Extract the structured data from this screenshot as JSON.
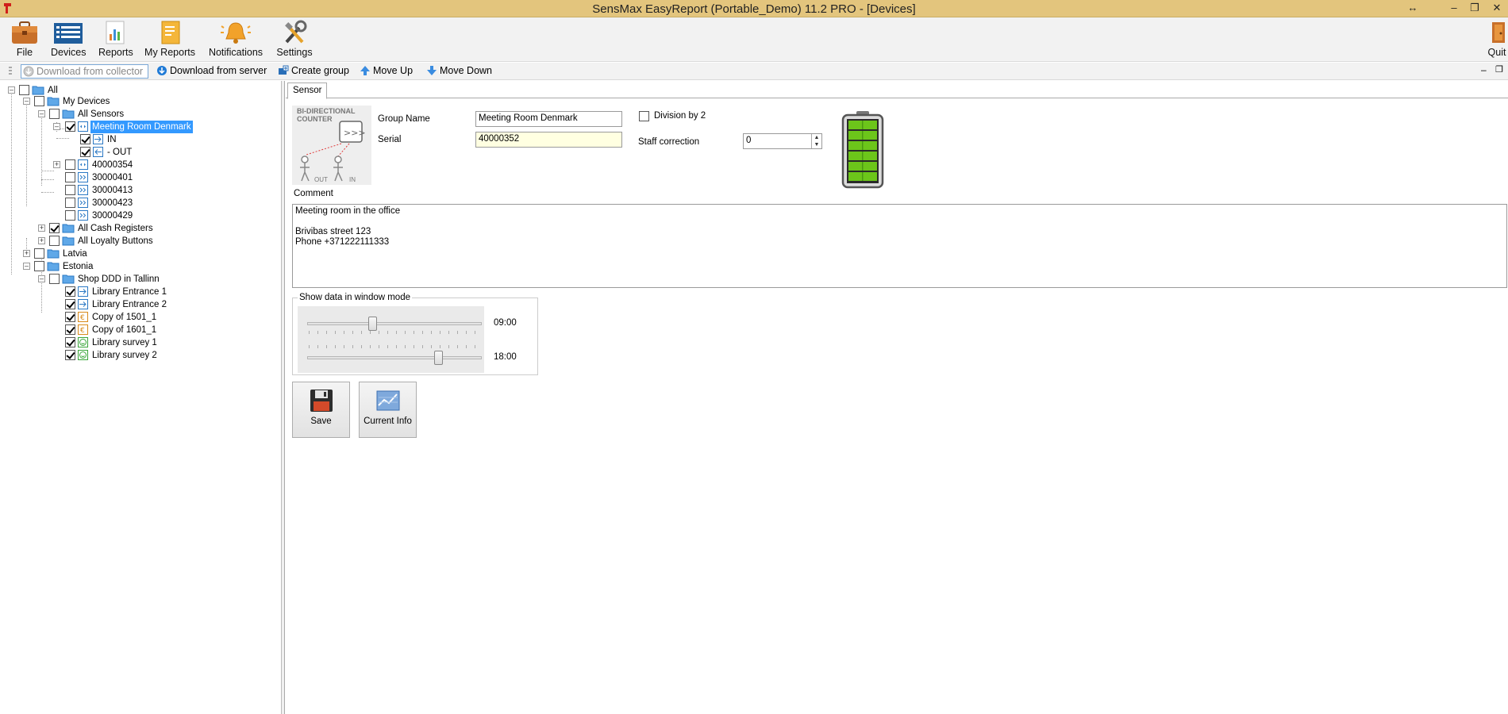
{
  "window": {
    "title": "SensMax EasyReport (Portable_Demo) 11.2 PRO - [Devices]",
    "controls": [
      "↔",
      "–",
      "❐",
      "✕"
    ]
  },
  "ribbon": {
    "file": "File",
    "devices": "Devices",
    "reports": "Reports",
    "my_reports": "My Reports",
    "notifications": "Notifications",
    "settings": "Settings",
    "quit": "Quit"
  },
  "toolbar": {
    "download_collector": "Download from collector",
    "download_server": "Download from server",
    "create_group": "Create group",
    "move_up": "Move Up",
    "move_down": "Move Down"
  },
  "tree": {
    "all": "All",
    "my_devices": "My Devices",
    "all_sensors": "All Sensors",
    "meeting_room": "Meeting Room Denmark",
    "in": "IN",
    "out": "- OUT",
    "s1": "40000354",
    "s2": "30000401",
    "s3": "30000413",
    "s4": "30000423",
    "s5": "30000429",
    "cash": "All Cash Registers",
    "loyalty": "All Loyalty Buttons",
    "latvia": "Latvia",
    "estonia": "Estonia",
    "shop": "Shop DDD in Tallinn",
    "lib1": "Library Entrance 1",
    "lib2": "Library Entrance 2",
    "copy1": "Copy of 1501_1",
    "copy2": "Copy of 1601_1",
    "survey1": "Library survey 1",
    "survey2": "Library survey 2"
  },
  "sensor": {
    "tab": "Sensor",
    "device_caption_1": "BI-DIRECTIONAL",
    "device_caption_2": "COUNTER",
    "out_tag": "OUT",
    "in_tag": "IN",
    "group_name_label": "Group Name",
    "group_name_value": "Meeting Room Denmark",
    "serial_label": "Serial",
    "serial_value": "40000352",
    "division_label": "Division by 2",
    "staff_label": "Staff correction",
    "staff_value": "0",
    "comment_label": "Comment",
    "comment_value": "Meeting room in the office\n\nBrivibas street 123\nPhone +371222111333",
    "window_mode_label": "Show data in window mode",
    "time_start": "09:00",
    "time_end": "18:00",
    "slider_start_fraction": 0.375,
    "slider_end_fraction": 0.75,
    "battery_level": 1.0,
    "save_label": "Save",
    "current_info_label": "Current Info"
  },
  "colors": {
    "titlebar": "#e3c57d",
    "selection": "#3399ff",
    "battery_fill": "#6cc51a"
  }
}
